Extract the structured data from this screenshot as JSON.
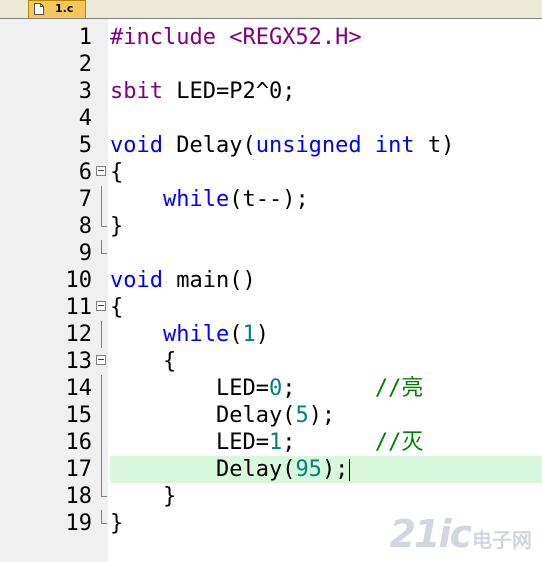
{
  "tab": {
    "label": "1.c"
  },
  "lines": [
    {
      "num": "1",
      "code": [
        {
          "t": "#include <REGX52.H>",
          "c": "pp"
        }
      ]
    },
    {
      "num": "2",
      "code": []
    },
    {
      "num": "3",
      "code": [
        {
          "t": "sbit",
          "c": "pp"
        },
        {
          "t": " LED=P2^0;",
          "c": ""
        }
      ]
    },
    {
      "num": "4",
      "code": []
    },
    {
      "num": "5",
      "code": [
        {
          "t": "void",
          "c": "kw"
        },
        {
          "t": " Delay(",
          "c": ""
        },
        {
          "t": "unsigned",
          "c": "kw"
        },
        {
          "t": " ",
          "c": ""
        },
        {
          "t": "int",
          "c": "kw"
        },
        {
          "t": " t)",
          "c": ""
        }
      ]
    },
    {
      "num": "6",
      "code": [
        {
          "t": "{",
          "c": ""
        }
      ]
    },
    {
      "num": "7",
      "code": [
        {
          "t": "    ",
          "c": ""
        },
        {
          "t": "while",
          "c": "kw"
        },
        {
          "t": "(t--);",
          "c": ""
        }
      ]
    },
    {
      "num": "8",
      "code": [
        {
          "t": "}",
          "c": ""
        }
      ]
    },
    {
      "num": "9",
      "code": []
    },
    {
      "num": "10",
      "code": [
        {
          "t": "void",
          "c": "kw"
        },
        {
          "t": " main()",
          "c": ""
        }
      ]
    },
    {
      "num": "11",
      "code": [
        {
          "t": "{",
          "c": ""
        }
      ]
    },
    {
      "num": "12",
      "code": [
        {
          "t": "    ",
          "c": ""
        },
        {
          "t": "while",
          "c": "kw"
        },
        {
          "t": "(",
          "c": ""
        },
        {
          "t": "1",
          "c": "num"
        },
        {
          "t": ")",
          "c": ""
        }
      ]
    },
    {
      "num": "13",
      "code": [
        {
          "t": "    {",
          "c": ""
        }
      ]
    },
    {
      "num": "14",
      "code": [
        {
          "t": "        LED=",
          "c": ""
        },
        {
          "t": "0",
          "c": "num"
        },
        {
          "t": ";      ",
          "c": ""
        },
        {
          "t": "//亮",
          "c": "cm"
        }
      ]
    },
    {
      "num": "15",
      "code": [
        {
          "t": "        Delay(",
          "c": ""
        },
        {
          "t": "5",
          "c": "num"
        },
        {
          "t": ");",
          "c": ""
        }
      ]
    },
    {
      "num": "16",
      "code": [
        {
          "t": "        LED=",
          "c": ""
        },
        {
          "t": "1",
          "c": "num"
        },
        {
          "t": ";      ",
          "c": ""
        },
        {
          "t": "//灭",
          "c": "cm"
        }
      ]
    },
    {
      "num": "17",
      "code": [
        {
          "t": "        Delay(",
          "c": ""
        },
        {
          "t": "95",
          "c": "num"
        },
        {
          "t": ");",
          "c": ""
        }
      ]
    },
    {
      "num": "18",
      "code": [
        {
          "t": "    }",
          "c": ""
        }
      ]
    },
    {
      "num": "19",
      "code": [
        {
          "t": "}",
          "c": ""
        }
      ]
    }
  ],
  "current_line": "17",
  "watermark": {
    "big": "21ic",
    "small": "电子网"
  }
}
